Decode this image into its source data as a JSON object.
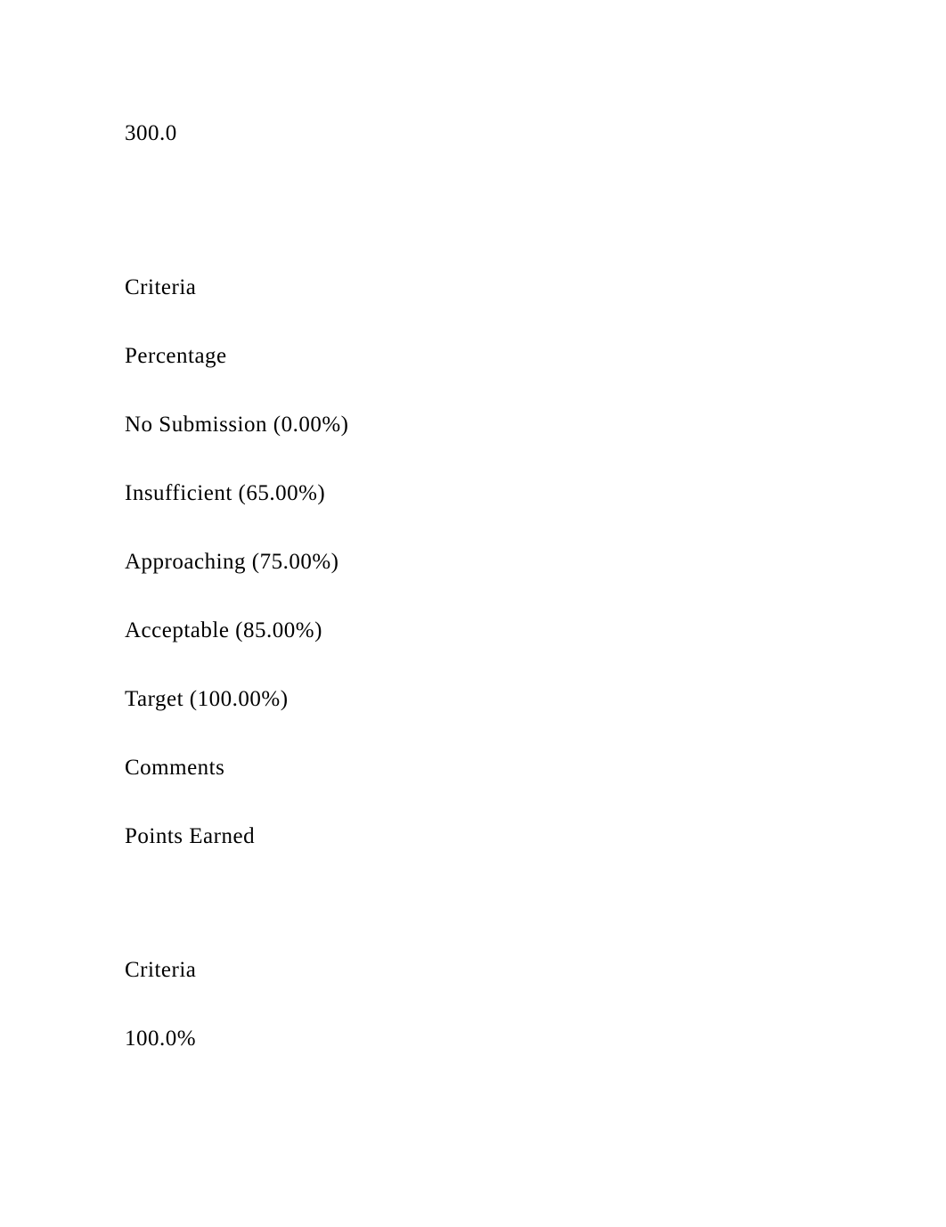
{
  "top_value": "300.0",
  "rubric_headers": {
    "criteria": "Criteria",
    "percentage": "Percentage",
    "no_submission": "No Submission (0.00%)",
    "insufficient": "Insufficient (65.00%)",
    "approaching": "Approaching (75.00%)",
    "acceptable": "Acceptable (85.00%)",
    "target": "Target (100.00%)",
    "comments": "Comments",
    "points_earned": "Points Earned"
  },
  "section2": {
    "criteria": "Criteria",
    "percent": "100.0%"
  }
}
